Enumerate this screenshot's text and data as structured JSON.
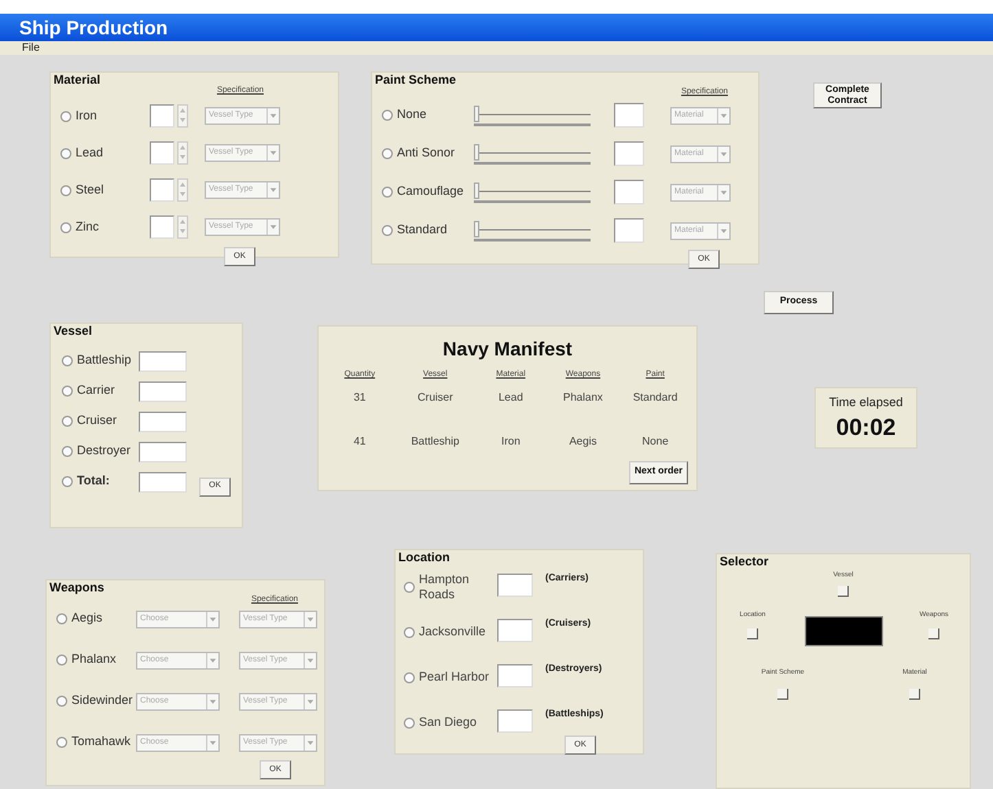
{
  "window": {
    "title": "Ship Production"
  },
  "menu": [
    "File"
  ],
  "material": {
    "title": "Material",
    "spec_header": "Specification",
    "ok": "OK",
    "items": [
      {
        "label": "Iron",
        "selected": false,
        "combo": "Vessel Type"
      },
      {
        "label": "Lead",
        "selected": false,
        "combo": "Vessel Type"
      },
      {
        "label": "Steel",
        "selected": false,
        "combo": "Vessel Type"
      },
      {
        "label": "Zinc",
        "selected": false,
        "combo": "Vessel Type"
      }
    ]
  },
  "paint": {
    "title": "Paint Scheme",
    "spec_header": "Specification",
    "ok": "OK",
    "items": [
      {
        "label": "None",
        "selected": false,
        "level": 0,
        "combo": "Material"
      },
      {
        "label": "Anti Sonor",
        "selected": false,
        "level": 0,
        "combo": "Material"
      },
      {
        "label": "Camouflage",
        "selected": false,
        "level": 0,
        "combo": "Material"
      },
      {
        "label": "Standard",
        "selected": false,
        "level": 0,
        "combo": "Material"
      }
    ]
  },
  "complete_button": "Complete Contract",
  "process_button": "Process",
  "vessel": {
    "title": "Vessel",
    "ok": "OK",
    "items": [
      {
        "label": "Battleship",
        "selected": false,
        "bold": false
      },
      {
        "label": "Carrier",
        "selected": false,
        "bold": false
      },
      {
        "label": "Cruiser",
        "selected": false,
        "bold": false
      },
      {
        "label": "Destroyer",
        "selected": false,
        "bold": false
      },
      {
        "label": "Total:",
        "selected": false,
        "bold": true
      }
    ]
  },
  "manifest": {
    "title": "Navy Manifest",
    "columns": [
      "Quantity",
      "Vessel",
      "Material",
      "Weapons",
      "Paint"
    ],
    "rows": [
      [
        "31",
        "Cruiser",
        "Lead",
        "Phalanx",
        "Standard"
      ],
      [
        "41",
        "Battleship",
        "Iron",
        "Aegis",
        "None"
      ]
    ],
    "button": "Next order"
  },
  "timer": {
    "label": "Time elapsed",
    "value": "00:02"
  },
  "weapons": {
    "title": "Weapons",
    "spec_header": "Specification",
    "ok": "OK",
    "items": [
      {
        "label": "Aegis",
        "selected": false,
        "combo": "Choose",
        "spec": "Vessel Type"
      },
      {
        "label": "Phalanx",
        "selected": false,
        "combo": "Choose",
        "spec": "Vessel Type"
      },
      {
        "label": "Sidewinder",
        "selected": false,
        "combo": "Choose",
        "spec": "Vessel Type"
      },
      {
        "label": "Tomahawk",
        "selected": false,
        "combo": "Choose",
        "spec": "Vessel Type"
      }
    ]
  },
  "location": {
    "title": "Location",
    "ok": "OK",
    "items": [
      {
        "label": "Hampton Roads",
        "selected": false,
        "note": "(Carriers)"
      },
      {
        "label": "Jacksonville",
        "selected": false,
        "note": "(Cruisers)"
      },
      {
        "label": "Pearl Harbor",
        "selected": false,
        "note": "(Destroyers)"
      },
      {
        "label": "San Diego",
        "selected": false,
        "note": "(Battleships)"
      }
    ]
  },
  "selector": {
    "title": "Selector",
    "top": "Vessel",
    "left": "Location",
    "right": "Weapons",
    "bottom_left": "Paint Scheme",
    "bottom_right": "Material"
  }
}
